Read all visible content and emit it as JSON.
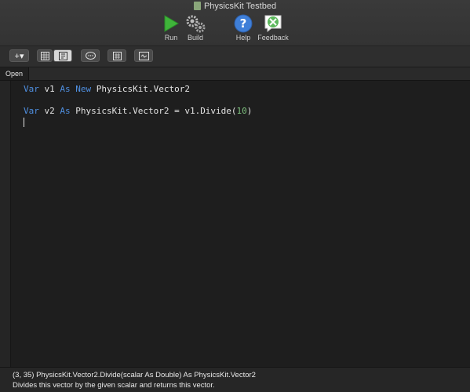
{
  "window": {
    "title": "PhysicsKit Testbed"
  },
  "toolbar": {
    "run_label": "Run",
    "build_label": "Build",
    "help_label": "Help",
    "feedback_label": "Feedback"
  },
  "secondary_toolbar": {
    "add_label": "+▾"
  },
  "tabs": [
    {
      "label": "Open"
    }
  ],
  "code": {
    "line1": {
      "kw1": "Var",
      "plain1": " v1 ",
      "kw2": "As",
      "plain2": " ",
      "kw3": "New",
      "plain3": " PhysicsKit.Vector2"
    },
    "line2": {
      "kw1": "Var",
      "plain1": " v2 ",
      "kw2": "As",
      "plain2": " PhysicsKit.Vector2 = v1.Divide(",
      "num": "10",
      "plain3": ")"
    }
  },
  "status": {
    "signature": "(3, 35) PhysicsKit.Vector2.Divide(scalar As Double) As PhysicsKit.Vector2",
    "description": "Divides this vector by the given scalar and returns this vector."
  },
  "icons": {
    "run": "play-icon",
    "build": "gears-icon",
    "help": "question-icon",
    "feedback": "feedback-icon"
  },
  "colors": {
    "keyword": "#4f8fe0",
    "number": "#7ec07e",
    "background": "#1e1e1e"
  }
}
